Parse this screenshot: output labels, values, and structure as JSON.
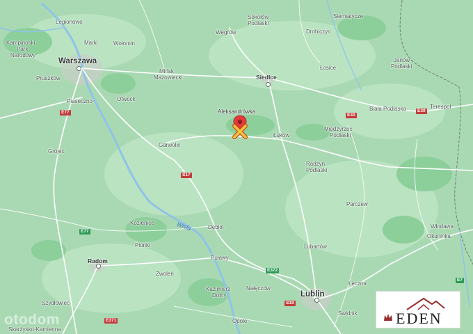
{
  "map": {
    "colors": {
      "land": "#a9d9b3",
      "road": "#ffffff",
      "river": "#8fc3e8",
      "pin": "#e23b3b",
      "marker": "#f3c43b"
    },
    "cities_major": [
      "Warszawa",
      "Siedlce",
      "Radom",
      "Lublin",
      "Aleksandrówka"
    ],
    "places": [
      "Legionowo",
      "Marki",
      "Wołomin",
      "Kampinoski",
      "Park",
      "Narodowy",
      "Pruszków",
      "Piaseczno",
      "Otwock",
      "Grójec",
      "Garwolin",
      "Mińsk",
      "Mazowiecki",
      "Węgrów",
      "Sokołów",
      "Podlaski",
      "Siemiatycze",
      "Drohiczyn",
      "Łosice",
      "Janów",
      "Podlaski",
      "Biała Podlaska",
      "Terespol",
      "Międzyrzec",
      "Podlaski",
      "Łuków",
      "Radzyń",
      "Podlaski",
      "Parczew",
      "Włodawa",
      "Okuninka",
      "Lubartów",
      "Łęczna",
      "Świdnik",
      "Kozienice",
      "Dęblin",
      "Pionki",
      "Puławy",
      "Zwoleń",
      "Kazimierz",
      "Dolny",
      "Nałęczów",
      "Opole",
      "Szydłowiec",
      "Skarżysko-Kamienna"
    ],
    "river_label": "Wisła",
    "road_signs": [
      "E77",
      "S17",
      "E30",
      "E30",
      "E77",
      "E372",
      "S19",
      "E371",
      "E7"
    ],
    "marker": {
      "pin_label": "Aleksandrówka",
      "pin_icon": "location-pin-icon",
      "marker_icon": "cross-marker-icon"
    }
  },
  "watermark": "otodom",
  "logo": {
    "text": "EDEN",
    "icon": "house-roof-icon"
  }
}
